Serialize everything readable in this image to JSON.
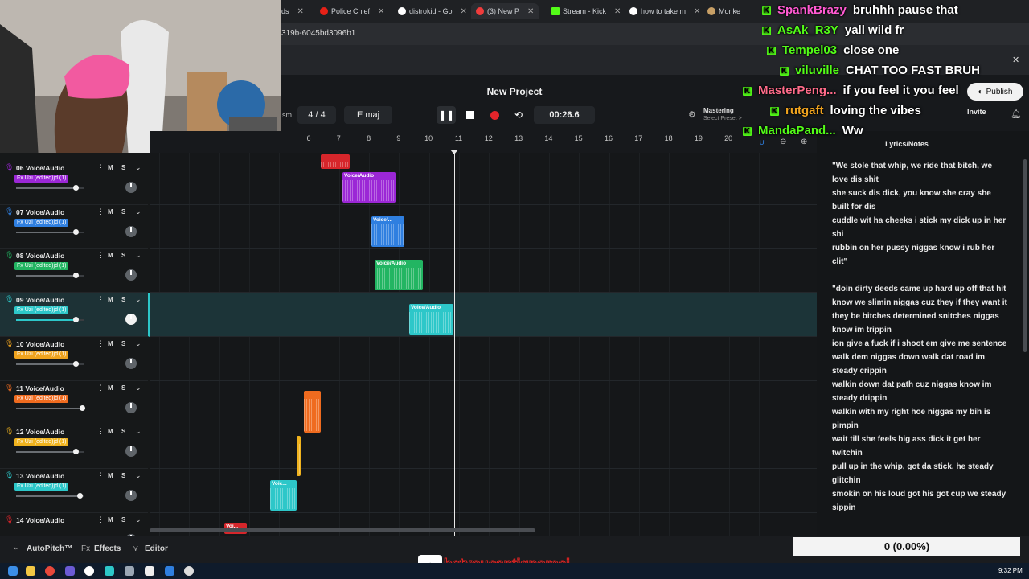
{
  "browser": {
    "tabs": [
      {
        "label": "ds",
        "icon": "page-icon"
      },
      {
        "label": "Police Chief",
        "icon": "youtube-icon"
      },
      {
        "label": "distrokid - Go",
        "icon": "google-icon"
      },
      {
        "label": "(3) New P",
        "icon": "bandlab-icon"
      },
      {
        "label": "Stream - Kick",
        "icon": "kick-icon"
      },
      {
        "label": "how to take m",
        "icon": "google-icon"
      },
      {
        "label": "Monke",
        "icon": "page-icon"
      }
    ],
    "url": "319b-6045bd3096b1"
  },
  "project": {
    "title": "New Project",
    "zoom_label": "sm",
    "time_signature": "4 / 4",
    "key": "E maj",
    "time": "00:26.6",
    "mastering_label": "Mastering",
    "mastering_preset": "Select Preset >",
    "publish_label": "Publish",
    "invite_label": "Invite",
    "colors": {
      "record": "#e4252b",
      "accent": "#2dc7c9"
    }
  },
  "ruler": [
    "6",
    "7",
    "8",
    "9",
    "10",
    "11",
    "12",
    "13",
    "14",
    "15",
    "16",
    "17",
    "18",
    "19",
    "20"
  ],
  "tracks": [
    {
      "name": "06 Voice/Audio",
      "fx": "Fx Uzi (edited)jd (1)",
      "color": "#9b27d6",
      "volume": 0.88,
      "icon": "mic-icon"
    },
    {
      "name": "07 Voice/Audio",
      "fx": "Fx Uzi (edited)jd (1)",
      "color": "#2f7fe0",
      "volume": 0.88,
      "icon": "mic-icon"
    },
    {
      "name": "08 Voice/Audio",
      "fx": "Fx Uzi (edited)jd (1)",
      "color": "#22b562",
      "volume": 0.88,
      "icon": "mic-icon"
    },
    {
      "name": "09 Voice/Audio",
      "fx": "Fx Uzi (edited)jd (1)",
      "color": "#2dc7c9",
      "volume": 0.88,
      "icon": "mic-icon"
    },
    {
      "name": "10 Voice/Audio",
      "fx": "Fx Uzi (edited)jd (1)",
      "color": "#f0a31e",
      "volume": 0.88,
      "icon": "mic-icon"
    },
    {
      "name": "11 Voice/Audio",
      "fx": "Fx Uzi (edited)jd (1)",
      "color": "#ef6b1f",
      "volume": 0.98,
      "icon": "mic-icon"
    },
    {
      "name": "12 Voice/Audio",
      "fx": "Fx Uzi (edited)jd (1)",
      "color": "#f0b31e",
      "volume": 0.88,
      "icon": "mic-icon"
    },
    {
      "name": "13 Voice/Audio",
      "fx": "Fx Uzi (edited)jd (1)",
      "color": "#2dc7c9",
      "volume": 0.94,
      "icon": "mic-icon"
    },
    {
      "name": "14 Voice/Audio",
      "fx": "",
      "color": "#e4252b",
      "volume": 0.88,
      "icon": "mic-icon"
    }
  ],
  "clip_labels": {
    "c06": "Voice/Audio",
    "c07": "Voice/...",
    "c08": "Voice/Audio",
    "c09": "Voice/Audio",
    "c13": "Voic...",
    "c14": "Voi..."
  },
  "lyrics": {
    "title": "Lyrics/Notes",
    "lines": [
      "\"We stole that whip, we ride that bitch, we love dis shit",
      "she suck dis dick, you know she cray she built for dis",
      "cuddle wit ha cheeks i stick my dick up in her shi",
      "rubbin on her pussy niggas know i rub her clit\"",
      "",
      "\"doin dirty deeds came up hard up off that hit",
      "know we slimin niggas cuz they if they want it they be bitches determined snitches niggas know im trippin",
      "ion give a fuck if i shoot em give me sentence",
      "walk dem niggas down walk dat road im steady crippin",
      "walkin down dat path cuz niggas know im steady drippin",
      "walkin with my right hoe niggas my bih is pimpin",
      "wait till she feels big ass dick it get her twitchin",
      "pull up in the whip, got da stick, he steady glitchin",
      "smokin on his loud got his got cup we steady sippin"
    ]
  },
  "bottom": {
    "autopitch": "AutoPitch™",
    "effects": "Effects",
    "editor": "Editor",
    "counter": "0 (0.00%)"
  },
  "overlay": {
    "tiktok_handle": "betyoucantignoreej",
    "chat": [
      {
        "user": "SpankBrazy",
        "message": "bruhhh pause that",
        "color": "#ff5ad2"
      },
      {
        "user": "AsAk_R3Y",
        "message": "yall wild fr",
        "color": "#53fc18"
      },
      {
        "user": "Tempel03",
        "message": "close one",
        "color": "#53fc18"
      },
      {
        "user": "viluville",
        "message": "CHAT TOO FAST BRUH",
        "color": "#53fc18"
      },
      {
        "user": "MasterPeng...",
        "message": "if you feel it you feel",
        "color": "#ff6b8a"
      },
      {
        "user": "rutgaft",
        "message": "loving the vibes",
        "color": "#f0a31e"
      },
      {
        "user": "MandaPand...",
        "message": "Ww",
        "color": "#53fc18"
      }
    ]
  },
  "taskbar": {
    "clock": "9:32 PM"
  }
}
